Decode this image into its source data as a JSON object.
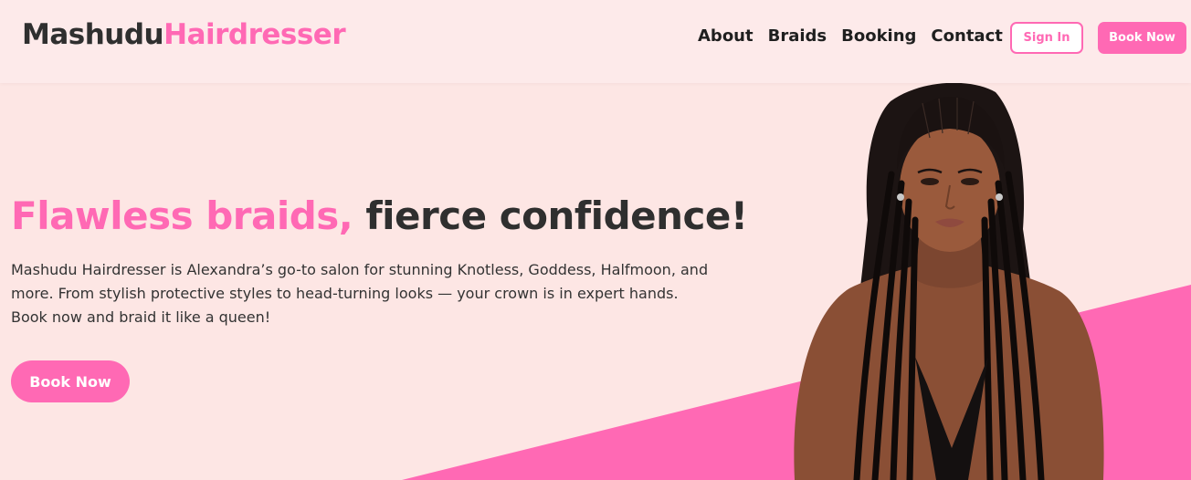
{
  "header": {
    "logo_part1": "Mashudu",
    "logo_part2": "Hairdresser",
    "nav": [
      "About",
      "Braids",
      "Booking",
      "Contact"
    ],
    "signin_label": "Sign In",
    "booknow_label": "Book Now"
  },
  "hero": {
    "title_pink": "Flawless braids,",
    "title_dark": " fierce confidence!",
    "description": "Mashudu Hairdresser is Alexandra’s go-to salon for stunning Knotless, Goddess, Halfmoon, and more. From stylish protective styles to head-turning looks — your crown is in expert hands. Book now and braid it like a queen!",
    "cta_label": "Book Now"
  },
  "colors": {
    "accent": "#ff69b4",
    "background": "#fde6e4",
    "text_dark": "#2f2f2f"
  }
}
